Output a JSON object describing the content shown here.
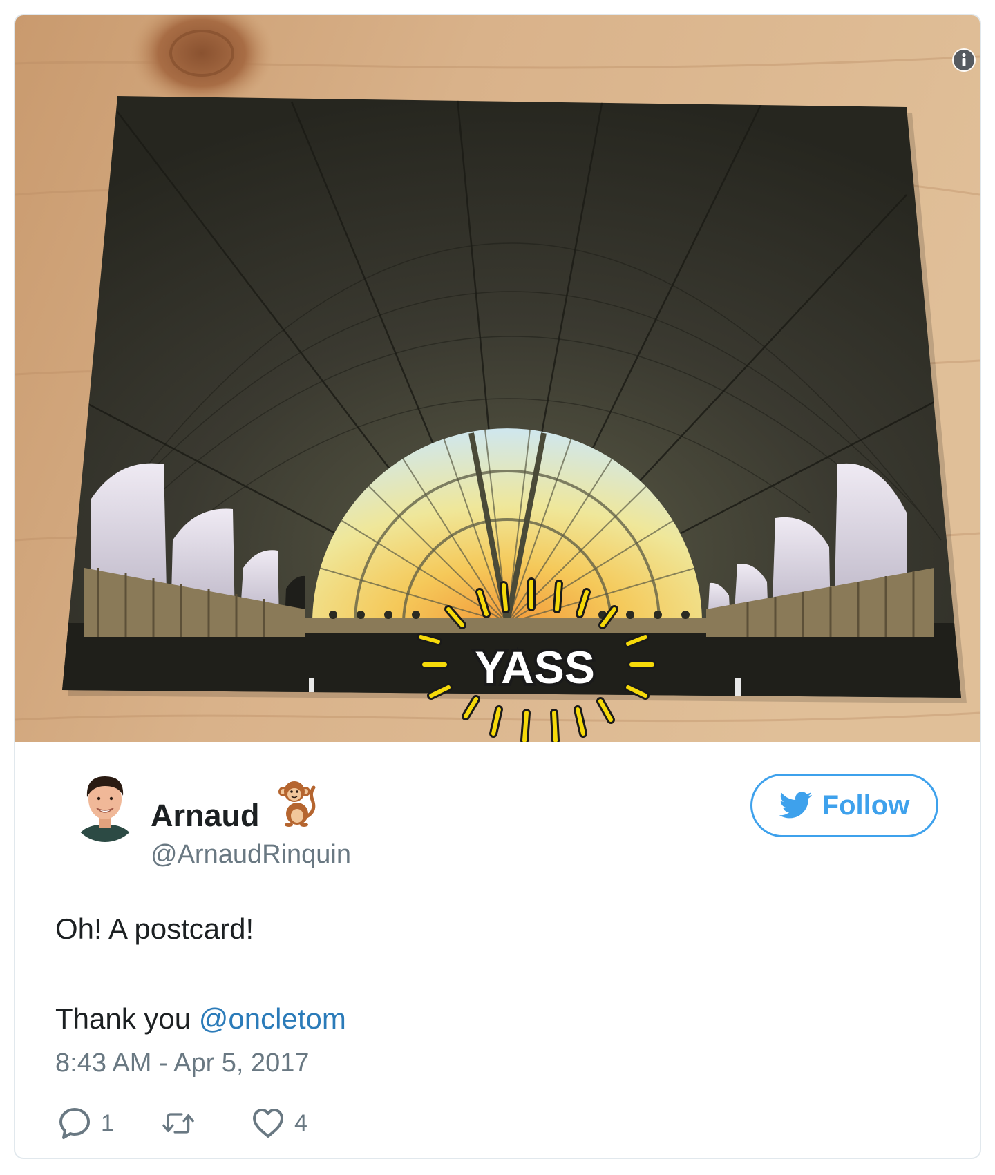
{
  "media": {
    "sticker_text": "YASS"
  },
  "author": {
    "display_name": "Arnaud",
    "handle": "@ArnaudRinquin",
    "emoji": "monkey"
  },
  "follow_button": {
    "label": "Follow"
  },
  "tweet": {
    "line1": "Oh! A postcard!",
    "line2_prefix": "Thank you ",
    "mention": "@oncletom",
    "timestamp": "8:43 AM - Apr 5, 2017"
  },
  "actions": {
    "reply_count": "1",
    "retweet_count": "",
    "like_count": "4"
  },
  "colors": {
    "accent_blue": "#3ea1ec",
    "link_blue": "#2b7bb9",
    "secondary_text": "#697882",
    "border": "#e1e8ed",
    "sticker_yellow": "#f5d90a"
  },
  "icons": [
    "info-icon",
    "twitter-bird-icon",
    "reply-icon",
    "retweet-icon",
    "heart-icon",
    "monkey-emoji"
  ]
}
